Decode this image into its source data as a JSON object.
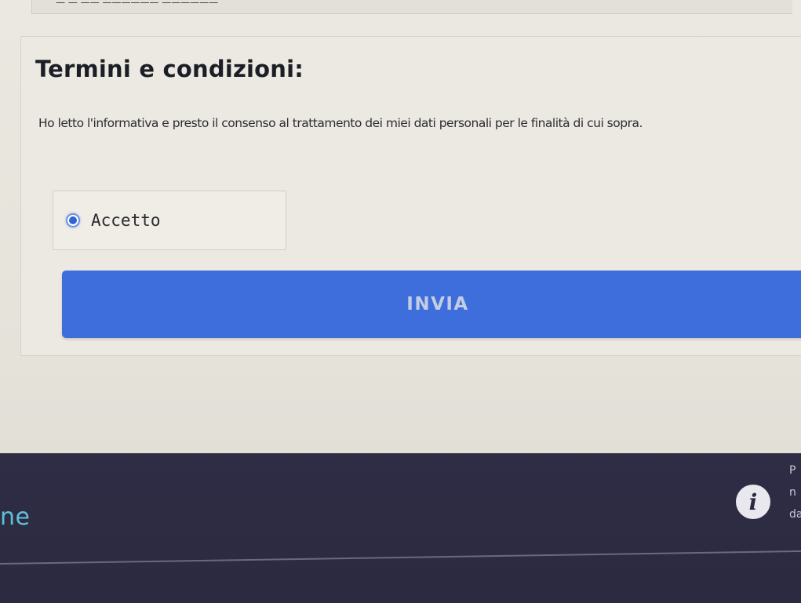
{
  "top_strip": {
    "text": "— —  —— —————— ——————"
  },
  "terms": {
    "title": "Termini e condizioni:",
    "body": "Ho letto l'informativa e presto il consenso al trattamento dei miei dati personali per le finalità di cui sopra.",
    "radio": {
      "label": "Accetto",
      "selected": true
    },
    "submit_label": "INVIA"
  },
  "footer": {
    "brand_partial": "ne",
    "info_icon": "info-icon",
    "side_text_lines": [
      "P",
      "n",
      "da"
    ]
  },
  "colors": {
    "button_blue": "#3e6ddc",
    "footer_bg": "#2e2d45",
    "brand_teal": "#5fc0d8",
    "radio_selected": "#2f63d8"
  }
}
